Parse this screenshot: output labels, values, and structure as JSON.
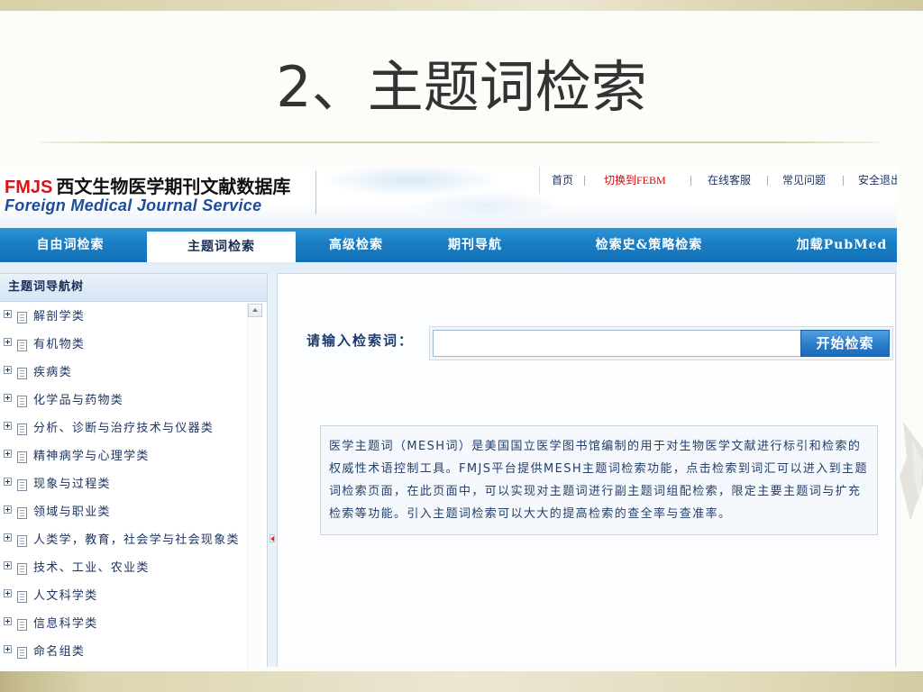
{
  "slide": {
    "title": "2、主题词检索"
  },
  "app": {
    "logo": {
      "abbr": "FMJS",
      "name_cn": "西文生物医学期刊文献数据库",
      "name_en": "Foreign Medical Journal Service"
    },
    "top_links": [
      {
        "label": "首页"
      },
      {
        "label": "切换到FEBM"
      },
      {
        "label": "在线客服"
      },
      {
        "label": "常见问题"
      },
      {
        "label": "安全退出"
      }
    ],
    "nav": {
      "items": [
        {
          "label": "自由词检索",
          "active": false
        },
        {
          "label": "主题词检索",
          "active": true
        },
        {
          "label": "高级检索",
          "active": false
        },
        {
          "label": "期刊导航",
          "active": false
        },
        {
          "label": "检索史&策略检索",
          "active": false
        },
        {
          "label": "加载PubMed",
          "active": false
        }
      ]
    },
    "tree": {
      "header": "主题词导航树",
      "expand_icon": "expand-plus",
      "node_icon": "document",
      "items": [
        {
          "label": "解剖学类"
        },
        {
          "label": "有机物类"
        },
        {
          "label": "疾病类"
        },
        {
          "label": "化学品与药物类"
        },
        {
          "label": "分析、诊断与治疗技术与仪器类"
        },
        {
          "label": "精神病学与心理学类"
        },
        {
          "label": "现象与过程类"
        },
        {
          "label": "领域与职业类"
        },
        {
          "label": "人类学，教育，社会学与社会现象类"
        },
        {
          "label": "技术、工业、农业类"
        },
        {
          "label": "人文科学类"
        },
        {
          "label": "信息科学类"
        },
        {
          "label": "命名组类"
        }
      ]
    },
    "search": {
      "label": "请输入检索词：",
      "input_value": "",
      "button_label": "开始检索"
    },
    "description": {
      "lines": [
        "医学主题词（MESH词）是美国国立医学图书馆编制的用于对生物医学文献进行标引和检索的",
        "权威性术语控制工具。FMJS平台提供MESH主题词检索功能，点击检索到词汇可以进入到主题",
        "词检索页面，在此页面中，可以实现对主题词进行副主题词组配检索，限定主要主题词与扩充",
        "检索等功能。引入主题词检索可以大大的提高检索的查全率与查准率。"
      ]
    }
  },
  "colors": {
    "nav_blue": "#1a7dc3",
    "logo_red": "#d7141a",
    "logo_blue": "#1d4c9c",
    "link_red": "#d00a0a",
    "text_navy": "#1f3b6b",
    "button_blue": "#1a6bbc",
    "title_gray": "#333333"
  }
}
